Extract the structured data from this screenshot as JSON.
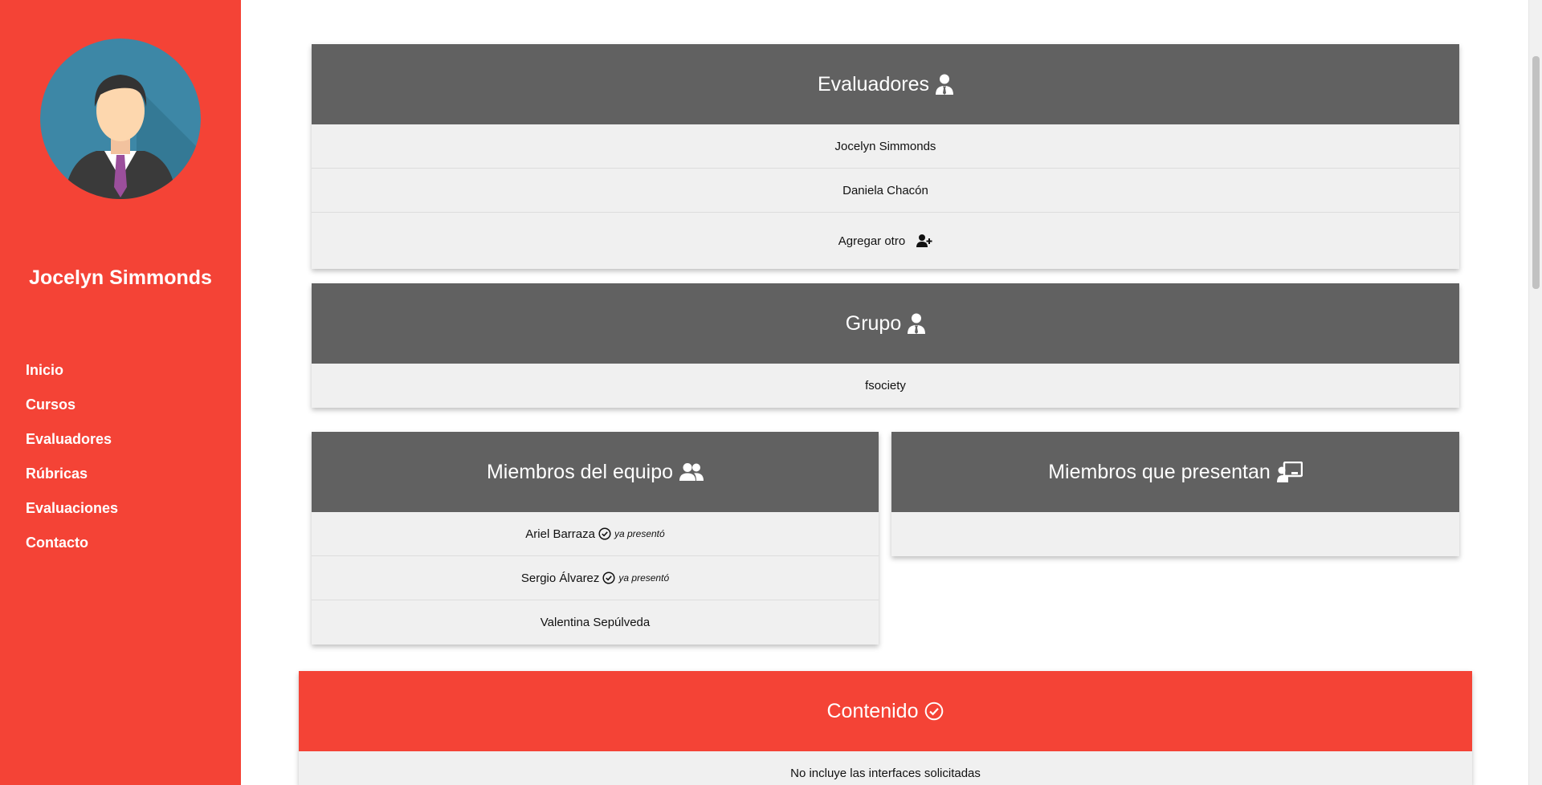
{
  "user": {
    "name": "Jocelyn Simmonds"
  },
  "nav": {
    "items": [
      {
        "label": "Inicio"
      },
      {
        "label": "Cursos"
      },
      {
        "label": "Evaluadores"
      },
      {
        "label": "Rúbricas"
      },
      {
        "label": "Evaluaciones"
      },
      {
        "label": "Contacto"
      }
    ]
  },
  "evaluadores": {
    "title": "Evaluadores",
    "icon": "user-tie-icon",
    "items": [
      "Jocelyn Simmonds",
      "Daniela Chacón"
    ],
    "add_label": "Agregar otro",
    "add_icon": "user-plus-icon"
  },
  "grupo": {
    "title": "Grupo",
    "icon": "user-tie-icon",
    "name": "fsociety"
  },
  "miembros": {
    "title": "Miembros del equipo",
    "icon": "users-icon",
    "items": [
      {
        "name": "Ariel Barraza",
        "status": "ya presentó"
      },
      {
        "name": "Sergio Álvarez",
        "status": "ya presentó"
      },
      {
        "name": "Valentina Sepúlveda"
      }
    ]
  },
  "presentan": {
    "title": "Miembros que presentan",
    "icon": "chalkboard-teacher-icon"
  },
  "contenido": {
    "title": "Contenido",
    "icon": "check-circle-icon",
    "text": "No incluye las interfaces solicitadas"
  },
  "colors": {
    "sidebar": "#f44336",
    "card_header": "#616161",
    "card_body": "#f0f0f0",
    "accent_red": "#f44336"
  }
}
